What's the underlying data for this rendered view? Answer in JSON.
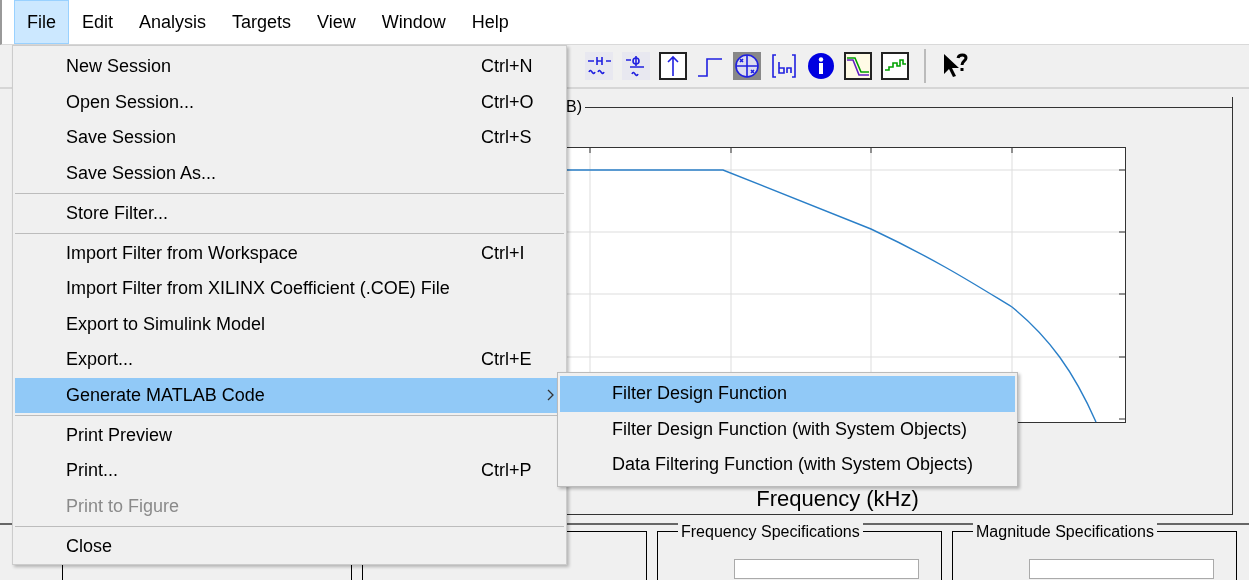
{
  "menubar": [
    {
      "label": "File",
      "selected": true
    },
    {
      "label": "Edit",
      "selected": false
    },
    {
      "label": "Analysis",
      "selected": false
    },
    {
      "label": "Targets",
      "selected": false
    },
    {
      "label": "View",
      "selected": false
    },
    {
      "label": "Window",
      "selected": false
    },
    {
      "label": "Help",
      "selected": false
    }
  ],
  "file_menu": [
    {
      "kind": "item",
      "label": "New Session",
      "shortcut": "Ctrl+N",
      "disabled": false,
      "selected": false
    },
    {
      "kind": "item",
      "label": "Open Session...",
      "shortcut": "Ctrl+O",
      "disabled": false,
      "selected": false
    },
    {
      "kind": "item",
      "label": "Save Session",
      "shortcut": "Ctrl+S",
      "disabled": false,
      "selected": false
    },
    {
      "kind": "item",
      "label": "Save Session As...",
      "disabled": false,
      "selected": false
    },
    {
      "kind": "separator"
    },
    {
      "kind": "item",
      "label": "Store Filter...",
      "disabled": false,
      "selected": false
    },
    {
      "kind": "separator"
    },
    {
      "kind": "item",
      "label": "Import Filter from Workspace",
      "shortcut": "Ctrl+I",
      "disabled": false,
      "selected": false
    },
    {
      "kind": "item",
      "label": "Import Filter from XILINX Coefficient (.COE) File",
      "disabled": false,
      "selected": false
    },
    {
      "kind": "item",
      "label": "Export to Simulink Model",
      "disabled": false,
      "selected": false
    },
    {
      "kind": "item",
      "label": "Export...",
      "shortcut": "Ctrl+E",
      "disabled": false,
      "selected": false
    },
    {
      "kind": "submenu",
      "label": "Generate MATLAB Code",
      "disabled": false,
      "selected": true
    },
    {
      "kind": "separator"
    },
    {
      "kind": "item",
      "label": "Print Preview",
      "disabled": false,
      "selected": false
    },
    {
      "kind": "item",
      "label": "Print...",
      "shortcut": "Ctrl+P",
      "disabled": false,
      "selected": false
    },
    {
      "kind": "item",
      "label": "Print to Figure",
      "disabled": true,
      "selected": false
    },
    {
      "kind": "separator"
    },
    {
      "kind": "item",
      "label": "Close",
      "disabled": false,
      "selected": false
    }
  ],
  "submenu": [
    {
      "label": "Filter Design Function",
      "selected": true
    },
    {
      "label": "Filter Design Function (with System Objects)",
      "selected": false
    },
    {
      "label": "Data Filtering Function (with System Objects)",
      "selected": false
    }
  ],
  "figure_panel": {
    "title": "B)",
    "xlabel": "Frequency (kHz)"
  },
  "spec_panels": [
    {
      "title": "Frequency Specifications"
    },
    {
      "title": "Magnitude Specifications"
    }
  ]
}
